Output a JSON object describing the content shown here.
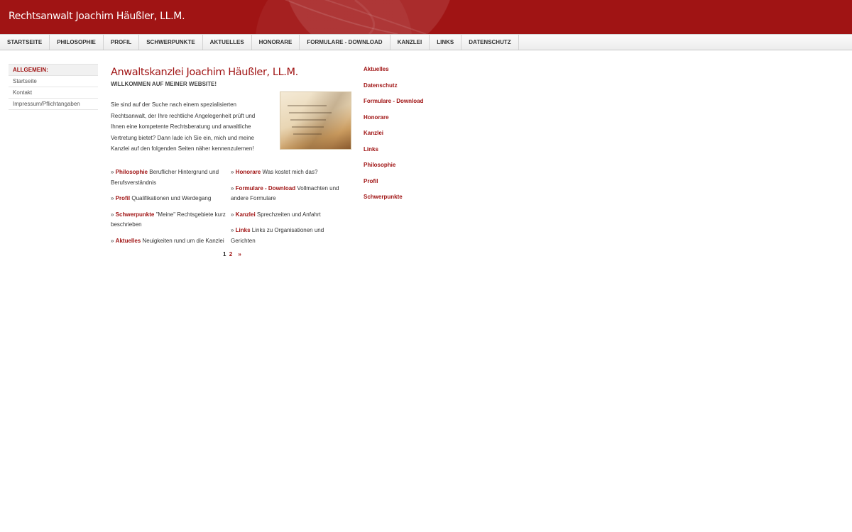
{
  "header": {
    "title": "Rechtsanwalt Joachim Häußler, LL.M."
  },
  "colors": {
    "brand": "#a01414",
    "nav_bg": "#ececec"
  },
  "topnav": [
    "STARTSEITE",
    "PHILOSOPHIE",
    "PROFIL",
    "SCHWERPUNKTE",
    "AKTUELLES",
    "HONORARE",
    "FORMULARE - DOWNLOAD",
    "KANZLEI",
    "LINKS",
    "DATENSCHUTZ"
  ],
  "leftnav": {
    "heading": "ALLGEMEIN:",
    "items": [
      "Startseite",
      "Kontakt",
      "Impressum/Pflichtangaben"
    ]
  },
  "main": {
    "title": "Anwaltskanzlei Joachim Häußler, LL.M.",
    "subtitle": "WILLKOMMEN AUF MEINER WEBSITE!",
    "intro": "Sie sind auf der Suche nach einem spezialisierten Rechtsanwalt, der Ihre rechtliche Angelegenheit prüft und Ihnen eine kompetente Rechtsberatung und anwaltliche Vertretung bietet? Dann lade ich Sie ein, mich und meine Kanzlei auf den folgenden Seiten näher kennenzulernen!",
    "links_left": [
      {
        "link": "Philosophie",
        "text": " Beruflicher Hintergrund und Berufsverständnis"
      },
      {
        "link": "Profil",
        "text": " Qualifikationen und Werdegang"
      },
      {
        "link": "Schwerpunkte",
        "text": " \"Meine\" Rechtsgebiete kurz beschrieben"
      },
      {
        "link": "Aktuelles",
        "text": " Neuigkeiten rund um die Kanzlei"
      }
    ],
    "links_right": [
      {
        "link": "Honorare",
        "text": " Was kostet mich das?"
      },
      {
        "link": "Formulare - Download",
        "text": " Vollmachten und andere Formulare"
      },
      {
        "link": "Kanzlei",
        "text": " Sprechzeiten und Anfahrt"
      },
      {
        "link": "Links",
        "text": " Links zu Organisationen und Gerichten"
      }
    ],
    "pagination": {
      "current": "1",
      "next_page": "2",
      "next": "»"
    }
  },
  "rightnav": [
    "Aktuelles",
    "Datenschutz",
    "Formulare - Download",
    "Honorare",
    "Kanzlei",
    "Links",
    "Philosophie",
    "Profil",
    "Schwerpunkte"
  ]
}
